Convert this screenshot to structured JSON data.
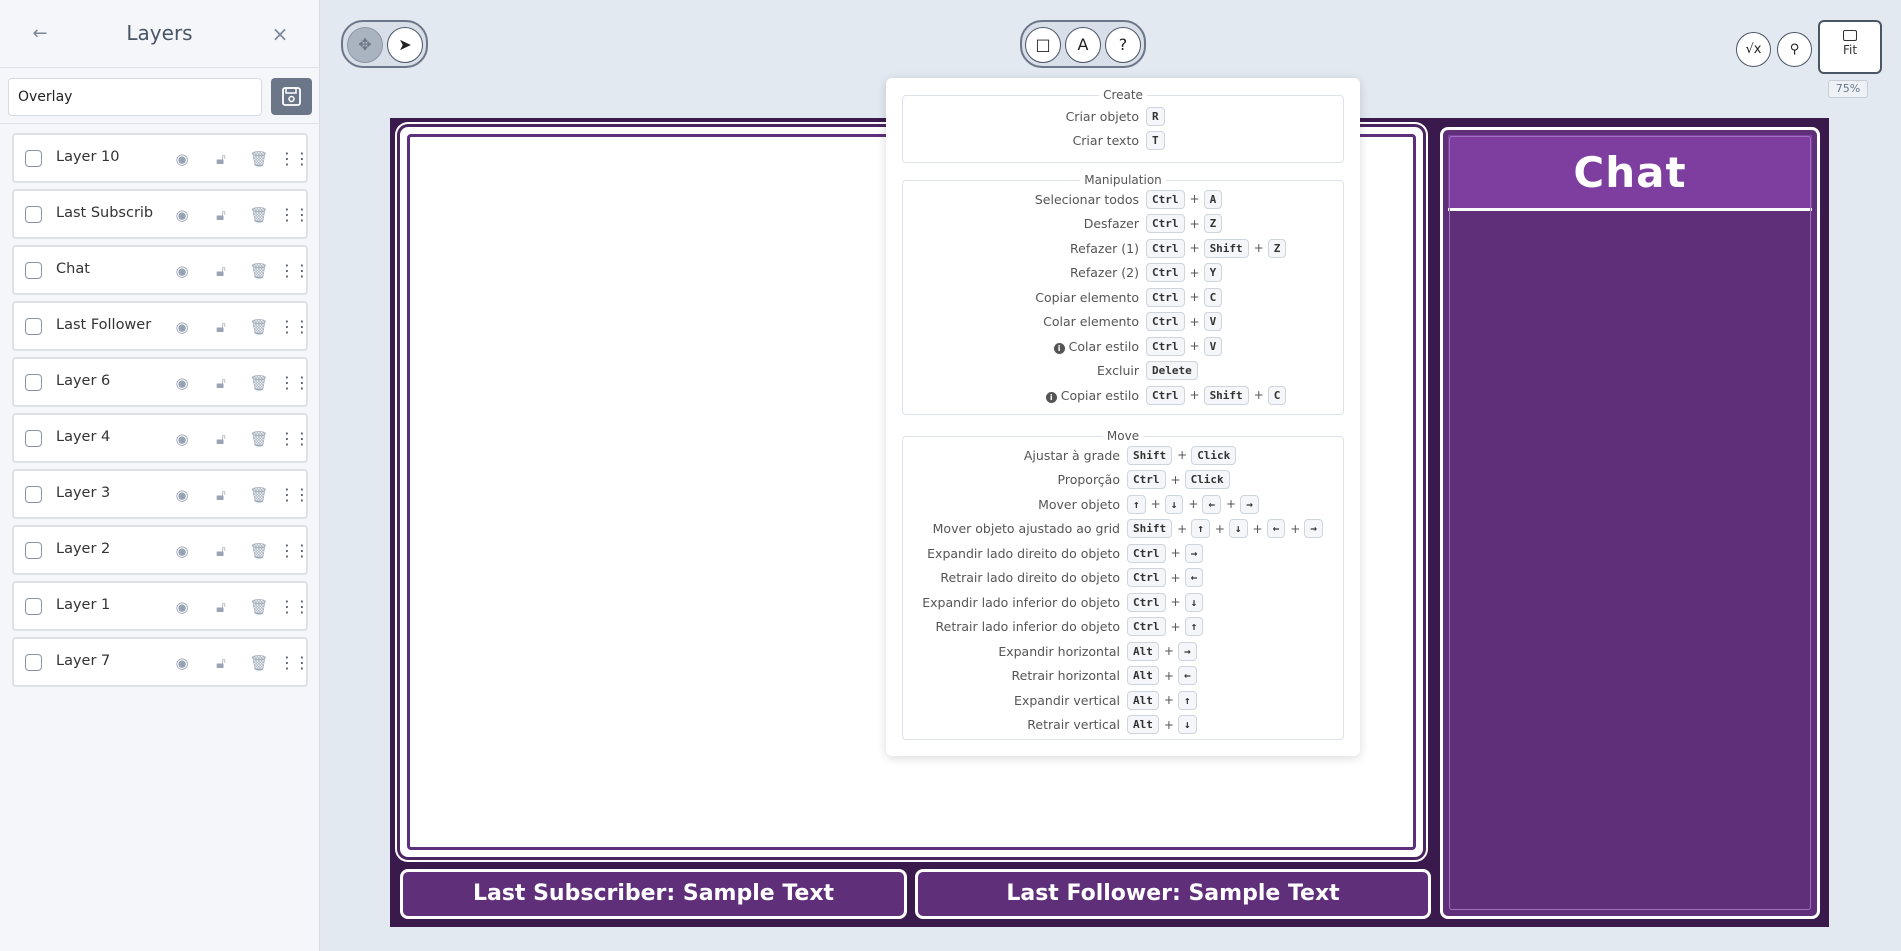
{
  "sidebar": {
    "title": "Layers",
    "back_icon": "arrow-left-icon",
    "close_icon": "close-icon",
    "overlay_name": "Overlay",
    "save_icon": "save-icon",
    "layers": [
      {
        "name": "Layer 10"
      },
      {
        "name": "Last Subscrib"
      },
      {
        "name": "Chat"
      },
      {
        "name": "Last Follower"
      },
      {
        "name": "Layer 6"
      },
      {
        "name": "Layer 4"
      },
      {
        "name": "Layer 3"
      },
      {
        "name": "Layer 2"
      },
      {
        "name": "Layer 1"
      },
      {
        "name": "Layer 7"
      }
    ]
  },
  "toolbar": {
    "move_icon": "move-icon",
    "select_icon": "cursor-icon",
    "rect_icon": "square-icon",
    "text_icon": "A",
    "help_icon": "?",
    "formula_icon": "formula-icon",
    "share_icon": "share-icon",
    "fit_label": "Fit",
    "zoom": "75%"
  },
  "canvas": {
    "chat_title": "Chat",
    "last_subscriber": "Last Subscriber: Sample Text",
    "last_follower": "Last Follower: Sample Text",
    "colors": {
      "bg": "#3a1a4c",
      "panel": "#5f2f7a",
      "header": "#7e3ea0"
    }
  },
  "shortcuts": {
    "create": {
      "title": "Create",
      "rows": [
        {
          "label": "Criar objeto",
          "keys": [
            "R"
          ]
        },
        {
          "label": "Criar texto",
          "keys": [
            "T"
          ]
        }
      ]
    },
    "manipulation": {
      "title": "Manipulation",
      "rows": [
        {
          "label": "Selecionar todos",
          "keys": [
            "Ctrl",
            "A"
          ]
        },
        {
          "label": "Desfazer",
          "keys": [
            "Ctrl",
            "Z"
          ]
        },
        {
          "label": "Refazer (1)",
          "keys": [
            "Ctrl",
            "Shift",
            "Z"
          ]
        },
        {
          "label": "Refazer (2)",
          "keys": [
            "Ctrl",
            "Y"
          ]
        },
        {
          "label": "Copiar elemento",
          "keys": [
            "Ctrl",
            "C"
          ]
        },
        {
          "label": "Colar elemento",
          "keys": [
            "Ctrl",
            "V"
          ]
        },
        {
          "label": "Colar estilo",
          "keys": [
            "Ctrl",
            "V"
          ],
          "info": true
        },
        {
          "label": "Excluir",
          "keys": [
            "Delete"
          ]
        },
        {
          "label": "Copiar estilo",
          "keys": [
            "Ctrl",
            "Shift",
            "C"
          ],
          "info": true
        }
      ]
    },
    "move": {
      "title": "Move",
      "rows": [
        {
          "label": "Ajustar à grade",
          "keys": [
            "Shift",
            "Click"
          ]
        },
        {
          "label": "Proporção",
          "keys": [
            "Ctrl",
            "Click"
          ]
        },
        {
          "label": "Mover objeto",
          "keys": [
            "↑",
            "↓",
            "←",
            "→"
          ]
        },
        {
          "label": "Mover objeto ajustado ao grid",
          "keys": [
            "Shift",
            "↑",
            "↓",
            "←",
            "→"
          ]
        },
        {
          "label": "Expandir lado direito do objeto",
          "keys": [
            "Ctrl",
            "→"
          ]
        },
        {
          "label": "Retrair lado direito do objeto",
          "keys": [
            "Ctrl",
            "←"
          ]
        },
        {
          "label": "Expandir lado inferior do objeto",
          "keys": [
            "Ctrl",
            "↓"
          ]
        },
        {
          "label": "Retrair lado inferior do objeto",
          "keys": [
            "Ctrl",
            "↑"
          ]
        },
        {
          "label": "Expandir horizontal",
          "keys": [
            "Alt",
            "→"
          ]
        },
        {
          "label": "Retrair horizontal",
          "keys": [
            "Alt",
            "←"
          ]
        },
        {
          "label": "Expandir vertical",
          "keys": [
            "Alt",
            "↑"
          ]
        },
        {
          "label": "Retrair vertical",
          "keys": [
            "Alt",
            "↓"
          ]
        }
      ]
    }
  }
}
